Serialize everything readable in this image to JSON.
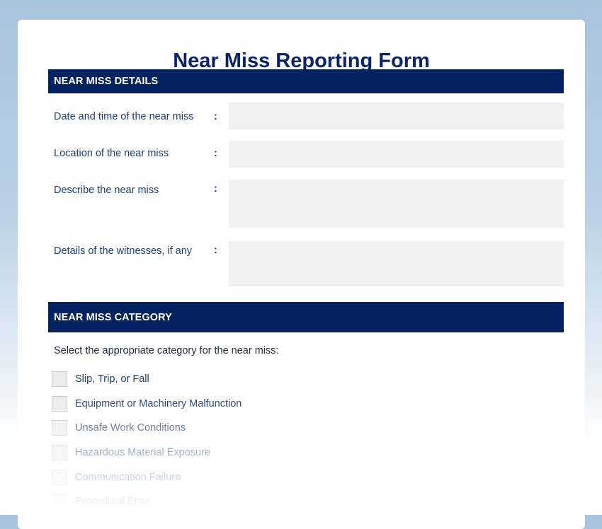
{
  "form": {
    "title": "Near Miss Reporting Form"
  },
  "details_section": {
    "heading": "NEAR MISS DETAILS",
    "fields": [
      {
        "label": "Date and time of the near miss",
        "value": ""
      },
      {
        "label": "Location of the near miss",
        "value": ""
      },
      {
        "label": "Describe the near miss",
        "value": ""
      },
      {
        "label": "Details of the witnesses, if any",
        "value": ""
      }
    ],
    "separator": ":"
  },
  "category_section": {
    "heading": "NEAR MISS CATEGORY",
    "prompt": "Select the appropriate category for the near miss:",
    "options": [
      {
        "label": "Slip, Trip, or Fall",
        "checked": false
      },
      {
        "label": "Equipment or Machinery Malfunction",
        "checked": false
      },
      {
        "label": "Unsafe Work Conditions",
        "checked": false
      },
      {
        "label": "Hazardous Material Exposure",
        "checked": false
      },
      {
        "label": "Communication Failure",
        "checked": false
      },
      {
        "label": "Procedural Error",
        "checked": false
      }
    ]
  },
  "colors": {
    "section_bar": "#042160",
    "title": "#0c2466",
    "field_background": "#f1f1f1",
    "label_text": "#1c3f6e"
  }
}
